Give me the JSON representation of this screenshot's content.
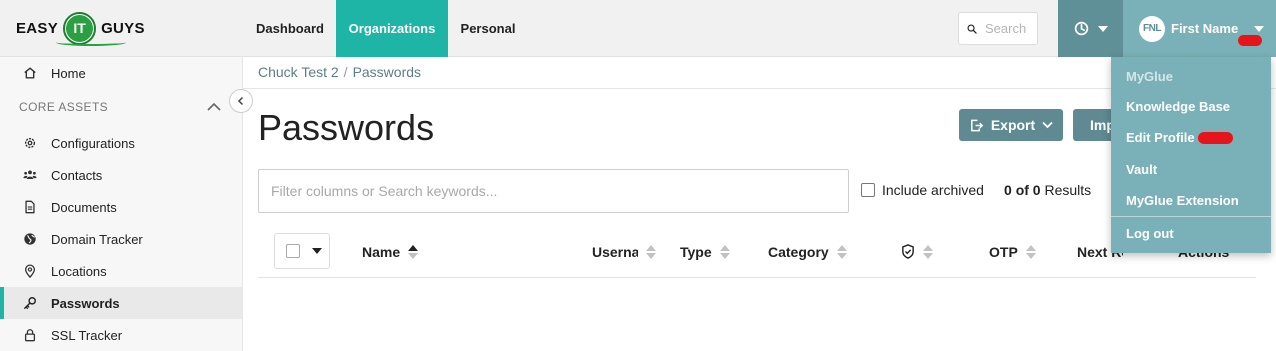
{
  "brand": {
    "left": "EASY",
    "middle": "IT",
    "right": "GUYS"
  },
  "nav": {
    "tabs": [
      {
        "label": "Dashboard",
        "active": false
      },
      {
        "label": "Organizations",
        "active": true
      },
      {
        "label": "Personal",
        "active": false
      }
    ],
    "search_placeholder": "Search",
    "user": {
      "initials": "FNL",
      "name": "First Name"
    }
  },
  "colors": {
    "accent": "#1eb5a7",
    "nav_dark": "#5f8f97",
    "nav_light": "#7ab0b7",
    "button": "#5f8a91",
    "redaction": "#e8141b"
  },
  "sidebar": {
    "home": {
      "label": "Home",
      "icon": "home-icon"
    },
    "section_label": "CORE ASSETS",
    "items": [
      {
        "label": "Configurations",
        "icon": "gear-icon",
        "active": false
      },
      {
        "label": "Contacts",
        "icon": "users-icon",
        "active": false
      },
      {
        "label": "Documents",
        "icon": "document-icon",
        "active": false
      },
      {
        "label": "Domain Tracker",
        "icon": "globe-icon",
        "active": false
      },
      {
        "label": "Locations",
        "icon": "map-pin-icon",
        "active": false
      },
      {
        "label": "Passwords",
        "icon": "key-icon",
        "active": true
      },
      {
        "label": "SSL Tracker",
        "icon": "lock-icon",
        "active": false
      }
    ]
  },
  "breadcrumb": {
    "org": "Chuck Test 2",
    "separator": "/",
    "page": "Passwords"
  },
  "page": {
    "title": "Passwords",
    "export_label": "Export",
    "import_label": "Import",
    "filter_placeholder": "Filter columns or Search keywords...",
    "include_archived_label": "Include archived",
    "results": {
      "shown": "0",
      "of_word": "of",
      "total": "0",
      "label": "Results"
    }
  },
  "table": {
    "columns": [
      "Name",
      "Username",
      "Type",
      "Category",
      "",
      "OTP",
      "Next Rotation",
      "Actions"
    ],
    "rows": []
  },
  "user_menu": {
    "items": [
      "MyGlue",
      "Knowledge Base",
      "Edit Profile",
      "Vault",
      "MyGlue Extension",
      "Log out"
    ]
  }
}
